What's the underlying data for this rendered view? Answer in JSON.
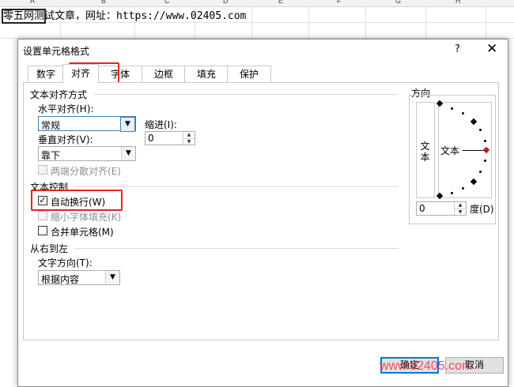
{
  "sheet": {
    "columns": [
      "A",
      "B",
      "C",
      "D",
      "E",
      "F",
      "G",
      "H"
    ],
    "cell_highlight": "零五网测",
    "cell_rest": "试文章，网址：https://www.02405.com"
  },
  "dialog": {
    "title": "设置单元格格式",
    "help": "?",
    "close": "✕",
    "tabs": [
      "数字",
      "对齐",
      "字体",
      "边框",
      "填充",
      "保护"
    ],
    "active_tab": "对齐",
    "text_alignment": {
      "group": "文本对齐方式",
      "horizontal_label": "水平对齐(H):",
      "horizontal_value": "常规",
      "vertical_label": "垂直对齐(V):",
      "vertical_value": "靠下",
      "indent_label": "缩进(I):",
      "indent_value": "0",
      "distributed_label": "两端分散对齐(E)"
    },
    "text_control": {
      "group": "文本控制",
      "wrap_label": "自动换行(W)",
      "wrap_checked": true,
      "shrink_label": "缩小字体填充(K)",
      "merge_label": "合并单元格(M)"
    },
    "rtl": {
      "group": "从右到左",
      "direction_label": "文字方向(T):",
      "direction_value": "根据内容"
    },
    "orientation": {
      "group": "方向",
      "vertical_text": "文本",
      "dial_text": "文本",
      "degrees_value": "0",
      "degrees_label": "度(D)"
    },
    "ok_label": "确定",
    "cancel_label": "取消"
  },
  "watermark": "www.02405.com",
  "colors": {
    "highlight_red": "#e8231e",
    "accent_blue": "#0078d7"
  }
}
